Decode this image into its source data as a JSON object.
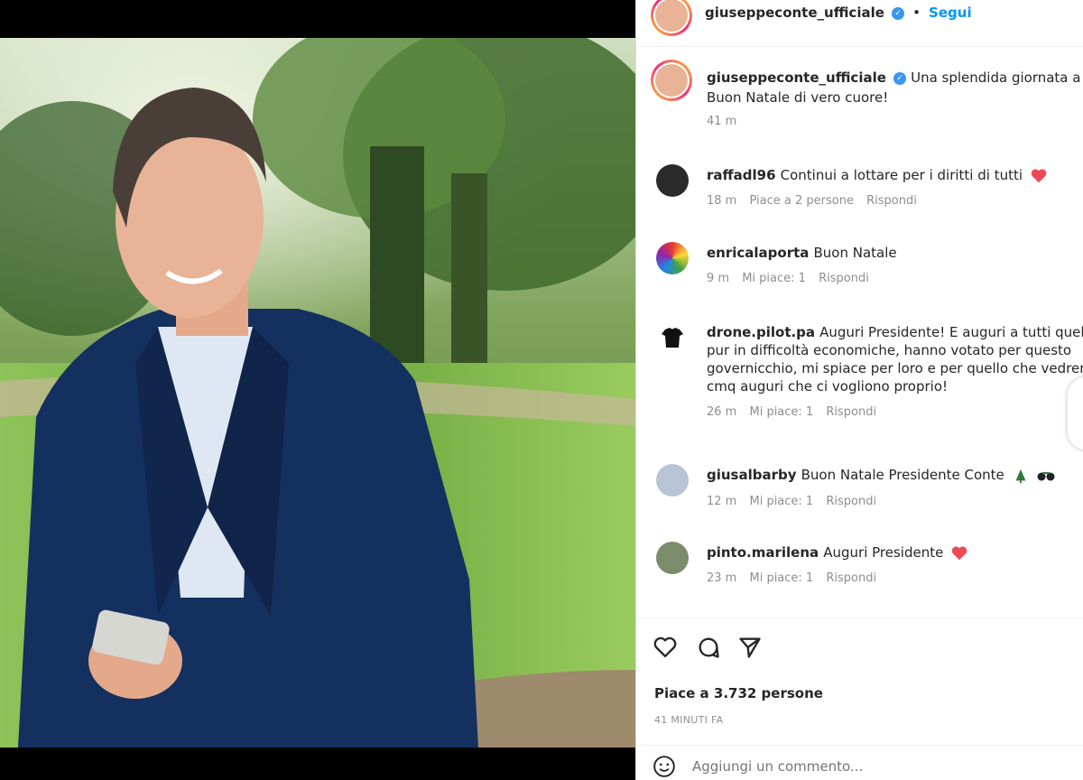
{
  "post": {
    "author": "giuseppeconte_ufficiale",
    "follow_label": "Segui",
    "caption_line1": "Una splendida giornata a tutti",
    "caption_line2": "Buon Natale di vero cuore!",
    "caption_time": "41 m"
  },
  "comments": [
    {
      "user": "raffadl96",
      "text": "Continui a lottare per i diritti di tutti",
      "emoji": "red-heart",
      "time": "18 m",
      "likes": "Piace a 2 persone",
      "reply": "Rispondi"
    },
    {
      "user": "enricalaporta",
      "text": "Buon Natale",
      "emoji": "",
      "time": "9 m",
      "likes": "Mi piace: 1",
      "reply": "Rispondi"
    },
    {
      "user": "drone.pilot.pa",
      "text_lines": [
        "Auguri Presidente! E auguri a tutti quelli che",
        "pur in difficoltà economiche, hanno votato per questo",
        "governicchio, mi spiace per loro e per quello che vedremo",
        "cmq auguri che ci vogliono proprio!"
      ],
      "time": "26 m",
      "likes": "Mi piace: 1",
      "reply": "Rispondi"
    },
    {
      "user": "giusalbarby",
      "text": "Buon Natale Presidente Conte",
      "emoji": "tree-and-glasses",
      "time": "12 m",
      "likes": "Mi piace: 1",
      "reply": "Rispondi"
    },
    {
      "user": "pinto.marilena",
      "text": "Auguri Presidente",
      "emoji": "red-heart",
      "time": "23 m",
      "likes": "Mi piace: 1",
      "reply": "Rispondi"
    }
  ],
  "footer": {
    "likes_label": "Piace a 3.732 persone",
    "timestamp": "41 MINUTI FA",
    "add_comment_placeholder": "Aggiungi un commento..."
  },
  "icons": {
    "like": "heart-outline-icon",
    "comment": "comment-icon",
    "share": "paper-plane-icon",
    "verified": "verified-badge-icon"
  },
  "colors": {
    "accent": "#0095f6",
    "verified": "#3897f0",
    "heart": "#ed4956",
    "jacket": "#14305f"
  }
}
